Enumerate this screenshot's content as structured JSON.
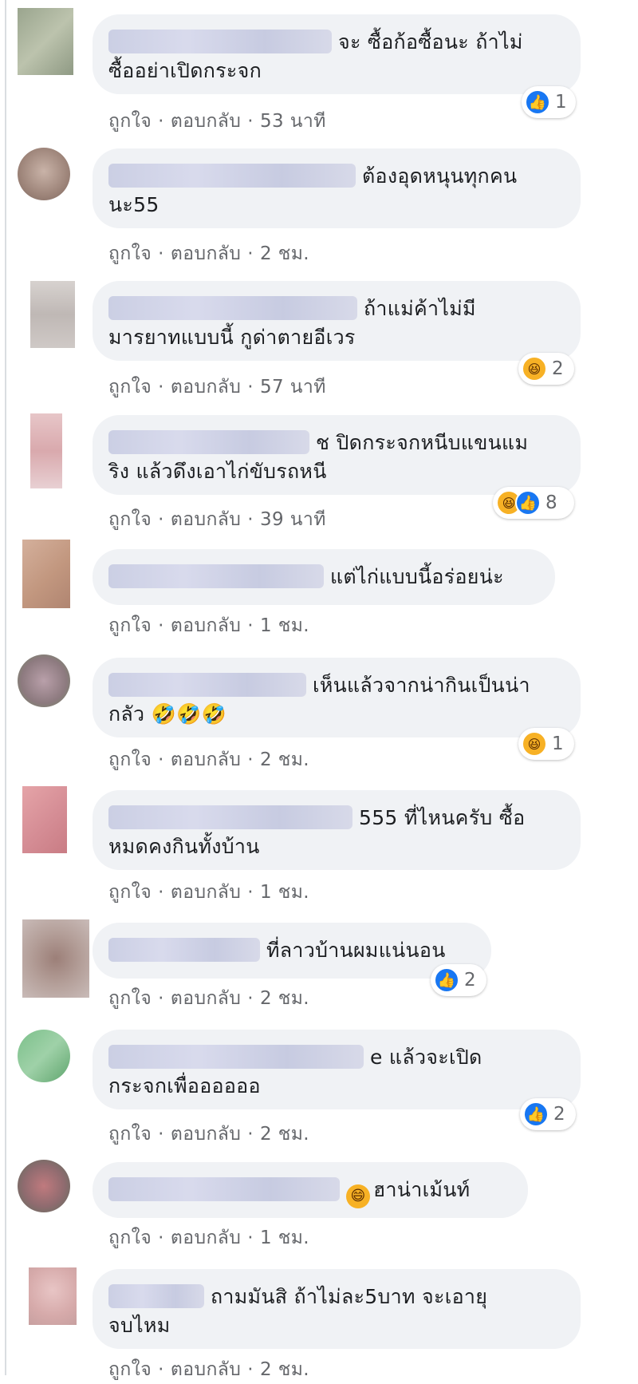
{
  "comments": [
    {
      "text": "จะ ซื้อก้อซื้อนะ ถ้าไม่\nซื้ออย่าเปิดกระจก",
      "like": "ถูกใจ",
      "reply": "ตอบกลับ",
      "time": "53 นาที",
      "reactions": {
        "icons": [
          "like"
        ],
        "count": "1"
      }
    },
    {
      "text": "ต้องอุดหนุนทุกคน\nนะ55",
      "like": "ถูกใจ",
      "reply": "ตอบกลับ",
      "time": "2 ชม.",
      "reactions": null
    },
    {
      "text": "ถ้าแม่ค้าไม่มี\nมารยาทแบบนี้ กูด่าตายอีเวร",
      "like": "ถูกใจ",
      "reply": "ตอบกลับ",
      "time": "57 นาที",
      "reactions": {
        "icons": [
          "haha"
        ],
        "count": "2"
      }
    },
    {
      "text": "ช ปิดกระจกหนีบแขนแม\nริง แล้วดึงเอาไก่ขับรถหนี",
      "like": "ถูกใจ",
      "reply": "ตอบกลับ",
      "time": "39 นาที",
      "reactions": {
        "icons": [
          "haha",
          "like"
        ],
        "count": "8"
      }
    },
    {
      "text": "แต่ไก่แบบนี้อร่อยน่ะ",
      "like": "ถูกใจ",
      "reply": "ตอบกลับ",
      "time": "1 ชม.",
      "reactions": null
    },
    {
      "text": "เห็นแล้วจากน่ากินเป็นน่า\nกลัว 🤣🤣🤣",
      "like": "ถูกใจ",
      "reply": "ตอบกลับ",
      "time": "2 ชม.",
      "reactions": {
        "icons": [
          "haha"
        ],
        "count": "1"
      }
    },
    {
      "text": "555 ที่ไหนครับ ซื้อ\nหมดคงกินทั้งบ้าน",
      "like": "ถูกใจ",
      "reply": "ตอบกลับ",
      "time": "1 ชม.",
      "reactions": null
    },
    {
      "text": "ที่ลาวบ้านผมแน่นอน",
      "like": "ถูกใจ",
      "reply": "ตอบกลับ",
      "time": "2 ชม.",
      "reactions": {
        "icons": [
          "like"
        ],
        "count": "2"
      }
    },
    {
      "text": "e แล้วจะเปิด\nกระจกเพื่ออออออ",
      "like": "ถูกใจ",
      "reply": "ตอบกลับ",
      "time": "2 ชม.",
      "reactions": {
        "icons": [
          "like"
        ],
        "count": "2"
      }
    },
    {
      "text": "ฮาน่าเม้นท์",
      "like": "ถูกใจ",
      "reply": "ตอบกลับ",
      "time": "1 ชม.",
      "reactions": null
    },
    {
      "text": "ถามมันสิ ถ้าไม่ละ5บาท จะเอายุ\nจบไหม",
      "like": "ถูกใจ",
      "reply": "ตอบกลับ",
      "time": "2 ชม.",
      "reactions": null
    }
  ],
  "separator": "·"
}
